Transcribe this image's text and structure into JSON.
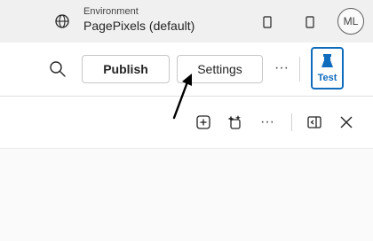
{
  "header": {
    "environment_label": "Environment",
    "environment_value": "PagePixels (default)",
    "avatar_initials": "ML"
  },
  "commandbar": {
    "publish_label": "Publish",
    "settings_label": "Settings",
    "more_label": "···",
    "test_label": "Test"
  },
  "colors": {
    "accent": "#0f6cbd",
    "topbar_bg": "#f0f0f0"
  },
  "icons": {
    "environment": "globe-icon",
    "search": "search-icon",
    "test": "flask-icon",
    "add": "add-square-icon",
    "copilot": "sparkle-icon",
    "more": "more-horizontal-icon",
    "panel": "panel-collapse-icon",
    "close": "close-icon"
  }
}
